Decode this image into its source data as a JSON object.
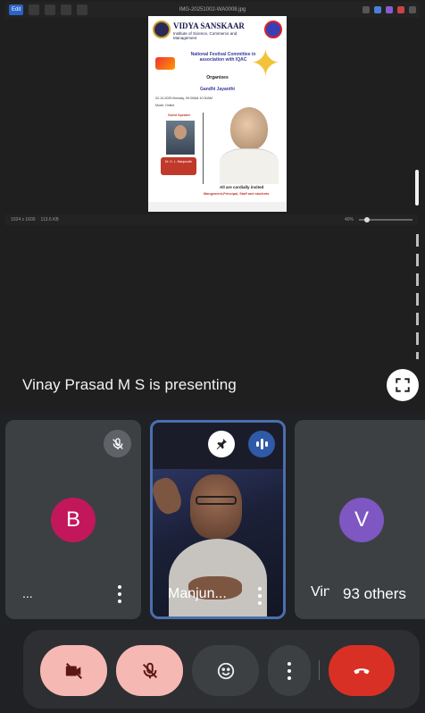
{
  "shared_screen": {
    "viewer_file_title": "IMG-20251002-WA0008.jpg",
    "viewer_button_label": "Edit",
    "viewer_status_text": "1024 x 1600",
    "viewer_file_size": "113.6 KB",
    "viewer_zoom": "40%",
    "poster": {
      "brand": "VIDYA SANSKAAR",
      "subtitle": "Institute of Science, Commerce and Management",
      "heading": "National Festival Committee in association with IQAC",
      "organises": "Organises",
      "event_title": "Gandhi Jayanthi",
      "event_datetime": "02-10-2025 Monday, 09:30AM-10:30AM",
      "event_mode": "Mode: Online",
      "guest_label": "Guest Speaker",
      "guest_name": "Dr. K. L. Manjunath",
      "invite_line": "All are cordially invited",
      "invite_audience": "Mangement,Principal, Staff and students"
    }
  },
  "presenting_banner": "Vinay Prasad M S is presenting",
  "icons": {
    "fullscreen": "fullscreen-icon",
    "mic_off": "mic-off-icon",
    "pin": "pin-icon",
    "speaking": "audio-level-icon",
    "camera_off": "camera-off-icon",
    "emoji": "emoji-icon",
    "end_call": "end-call-icon"
  },
  "participants": [
    {
      "initial": "B",
      "name": "...",
      "avatar_color": "#c2185b",
      "muted": true
    },
    {
      "name": "Manjun...",
      "video_on": true,
      "speaking": true
    },
    {
      "initial": "V",
      "name": "Vin",
      "avatar_color": "#7e57c2"
    }
  ],
  "others_label": "93 others",
  "controls": {
    "camera_state": "off",
    "mic_state": "off",
    "end_call_color": "#d93025"
  },
  "colors": {
    "background": "#202124",
    "tile": "#3c4043",
    "active_border": "#4a6fb0",
    "muted_control": "#f6b8b3"
  }
}
